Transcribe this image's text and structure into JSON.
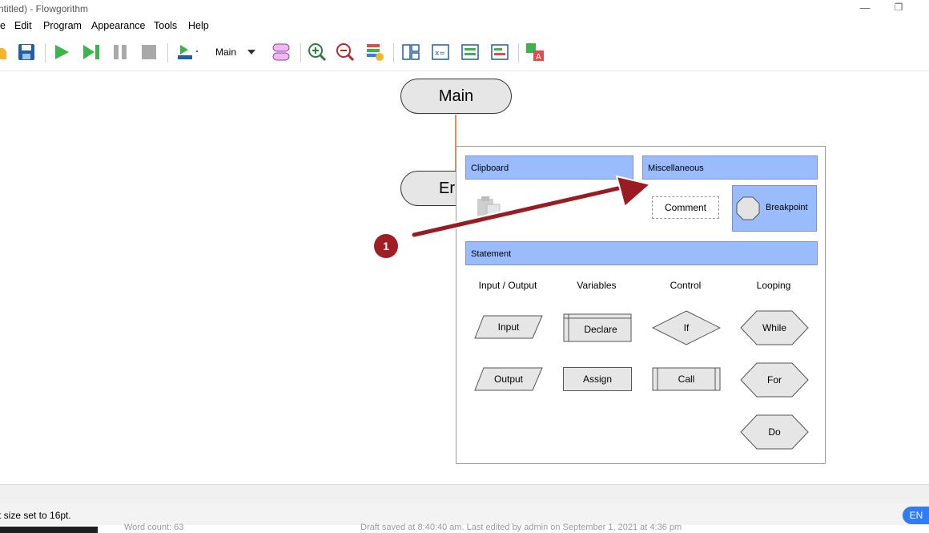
{
  "window": {
    "title": "ntitled) - Flowgorithm"
  },
  "menu": {
    "items": [
      "e",
      "Edit",
      "Program",
      "Appearance",
      "Tools",
      "Help"
    ]
  },
  "toolbar": {
    "function_select": "Main",
    "icons": [
      "open-icon",
      "save-icon",
      "run-icon",
      "step-icon",
      "pause-icon",
      "stop-icon",
      "speed-icon",
      "layout-icon",
      "zoom-in-icon",
      "zoom-out-icon",
      "styles-icon",
      "source-view-icon",
      "variables-view-icon",
      "console-view-icon",
      "chart-view-icon",
      "translate-icon"
    ]
  },
  "flowchart": {
    "start_label": "Main",
    "end_label": "Er"
  },
  "panel": {
    "clipboard_header": "Clipboard",
    "misc_header": "Miscellaneous",
    "comment_label": "Comment",
    "breakpoint_label": "Breakpoint",
    "statement_header": "Statement",
    "columns": [
      "Input / Output",
      "Variables",
      "Control",
      "Looping"
    ],
    "shapes": {
      "input": "Input",
      "output": "Output",
      "declare": "Declare",
      "assign": "Assign",
      "if": "If",
      "call": "Call",
      "while": "While",
      "for": "For",
      "do": "Do"
    }
  },
  "annotation": {
    "marker": "1",
    "marker_color": "#a01d24"
  },
  "status": {
    "message": "t size set to 16pt.",
    "language": "EN",
    "word_count": "Word count: 63",
    "draft_info": "Draft saved at 8:40:40 am. Last edited by admin on September 1, 2021 at 4:36 pm"
  },
  "colors": {
    "header_blue": "#9bbcfc",
    "connector": "#f08a4b",
    "accent": "#2e7cf6"
  }
}
